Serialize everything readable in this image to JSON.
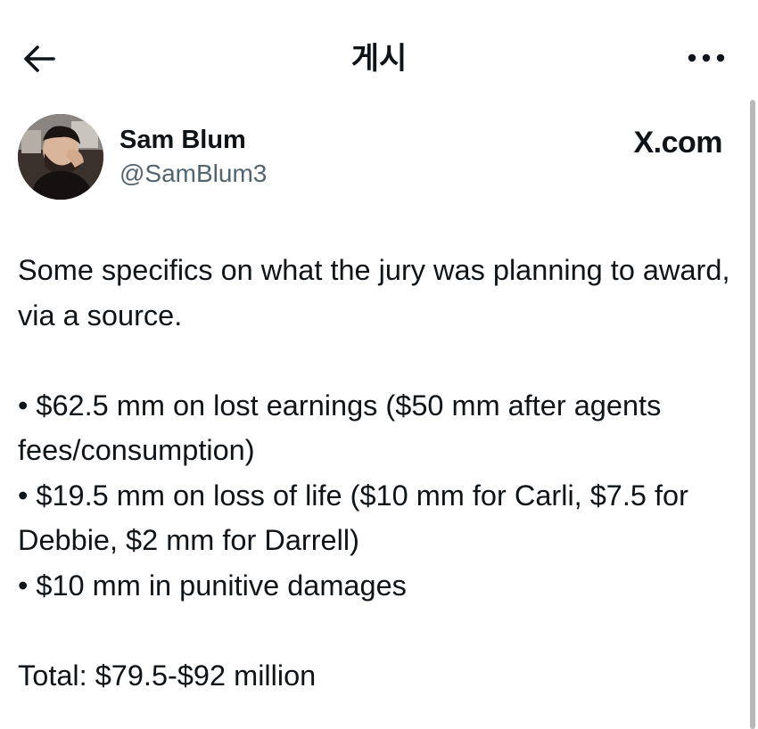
{
  "header": {
    "title": "게시",
    "back_icon": "arrow-left-icon",
    "more_icon": "more-horizontal-icon"
  },
  "author": {
    "display_name": "Sam Blum",
    "handle": "@SamBlum3",
    "avatar_icon": "user-avatar",
    "source": "X.com"
  },
  "tweet": {
    "intro": "Some specifics on what the jury was planning to award, via a source.",
    "bullets": [
      "• $62.5 mm on lost earnings ($50 mm after agents fees/consumption)",
      "• $19.5 mm on loss of life ($10 mm for Carli, $7.5 for Debbie, $2 mm for Darrell)",
      "• $10 mm in punitive damages"
    ],
    "total": "Total: $79.5-$92 million"
  }
}
